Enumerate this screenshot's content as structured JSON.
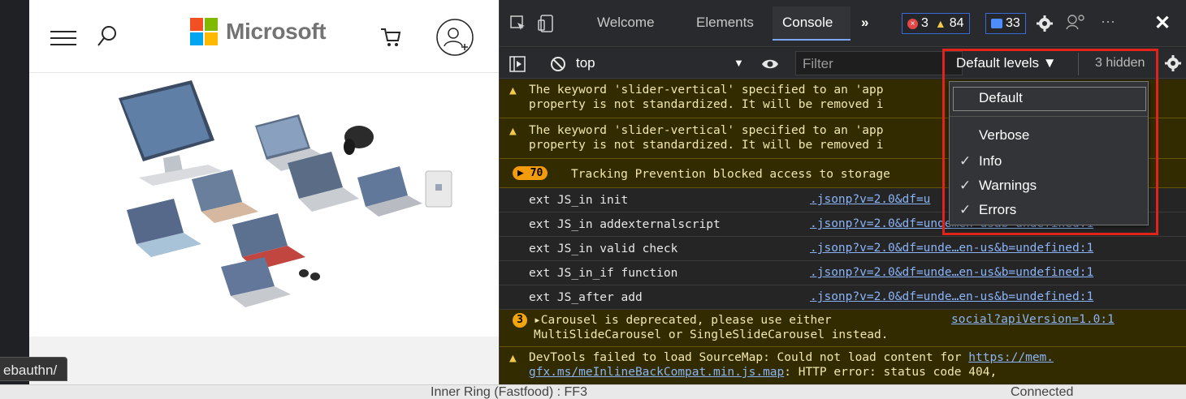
{
  "browser_page": {
    "logo_text": "Microsoft",
    "logo_colors": [
      "#f25022",
      "#7fba00",
      "#00a4ef",
      "#ffb900"
    ],
    "icons": [
      "menu-icon",
      "search-icon",
      "cart-icon",
      "account-icon"
    ],
    "url_tooltip": "ebauthn/"
  },
  "devtools": {
    "tabs": [
      {
        "label": "Welcome"
      },
      {
        "label": "Elements"
      },
      {
        "label": "Console",
        "active": true
      }
    ],
    "more_tabs": "»",
    "errors_count": "3",
    "warnings_count": "84",
    "issues_count": "33",
    "toolbar": {
      "context": "top",
      "filter_placeholder": "Filter",
      "levels_label": "Default levels ▼",
      "hidden_label": "3 hidden"
    },
    "levels_menu": {
      "items": [
        {
          "label": "Default",
          "checked": false
        },
        {
          "label": "Verbose",
          "checked": false
        },
        {
          "label": "Info",
          "checked": true
        },
        {
          "label": "Warnings",
          "checked": true
        },
        {
          "label": "Errors",
          "checked": true
        }
      ],
      "check_mark": "✓"
    },
    "console_rows": [
      {
        "type": "warn",
        "line1": "The keyword 'slider-vertical' specified to an 'app",
        "line2": "property is not standardized. It will be removed i"
      },
      {
        "type": "warn",
        "line1": "The keyword 'slider-vertical' specified to an 'app",
        "line2": "property is not standardized. It will be removed i"
      },
      {
        "type": "warn",
        "badge": "▶ 70",
        "line1": "Tracking Prevention blocked access to storage"
      },
      {
        "type": "log",
        "line1": "ext JS_in init",
        "source": ".jsonp?v=2.0&df=u"
      },
      {
        "type": "log",
        "line1": "ext JS_in addexternalscript",
        "source": ".jsonp?v=2.0&df=undemen-usab=undefined:1"
      },
      {
        "type": "log",
        "line1": "ext JS_in valid check",
        "source": ".jsonp?v=2.0&df=unde…en-us&b=undefined:1"
      },
      {
        "type": "log",
        "line1": "ext JS_in_if function",
        "source": ".jsonp?v=2.0&df=unde…en-us&b=undefined:1"
      },
      {
        "type": "log",
        "line1": "ext JS_after add",
        "source": ".jsonp?v=2.0&df=unde…en-us&b=undefined:1"
      },
      {
        "type": "warn",
        "badge": "3",
        "line1": "▸Carousel is deprecated, please use either",
        "line2": "MultiSlideCarousel or SingleSlideCarousel instead.",
        "source": "social?apiVersion=1.0:1"
      },
      {
        "type": "warn",
        "line1": "DevTools failed to load SourceMap: Could not load content for ",
        "link1": "https://mem.",
        "link2": "gfx.ms/meInlineBackCompat.min.js.map",
        "line2_rest": ": HTTP error: status code 404,"
      }
    ]
  },
  "status_bar": {
    "center": "Inner Ring (Fastfood) : FF3",
    "right": "Connected"
  }
}
